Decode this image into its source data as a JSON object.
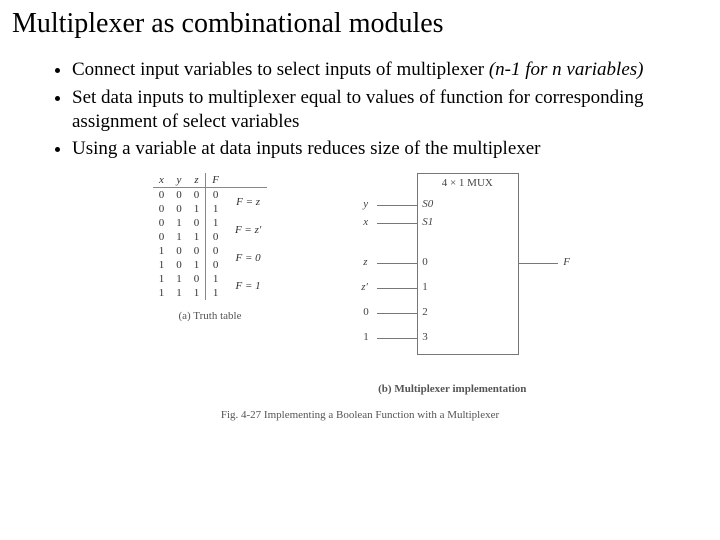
{
  "title": "Multiplexer as combinational modules",
  "bullets": {
    "b1a": "Connect input variables to select inputs of multiplexer ",
    "b1b": "(n-1 for n variables)",
    "b2": "Set data inputs to multiplexer equal to values of function for corresponding assignment of select variables",
    "b3": "Using a variable at data inputs reduces size of the multiplexer"
  },
  "truth_table": {
    "headers": {
      "x": "x",
      "y": "y",
      "z": "z",
      "F": "F"
    },
    "rows": [
      {
        "x": "0",
        "y": "0",
        "z": "0",
        "F": "0",
        "ann": ""
      },
      {
        "x": "0",
        "y": "0",
        "z": "1",
        "F": "1",
        "ann": "F = z"
      },
      {
        "x": "0",
        "y": "1",
        "z": "0",
        "F": "1",
        "ann": ""
      },
      {
        "x": "0",
        "y": "1",
        "z": "1",
        "F": "0",
        "ann": "F = z′"
      },
      {
        "x": "1",
        "y": "0",
        "z": "0",
        "F": "0",
        "ann": ""
      },
      {
        "x": "1",
        "y": "0",
        "z": "1",
        "F": "0",
        "ann": "F = 0"
      },
      {
        "x": "1",
        "y": "1",
        "z": "0",
        "F": "1",
        "ann": ""
      },
      {
        "x": "1",
        "y": "1",
        "z": "1",
        "F": "1",
        "ann": "F = 1"
      }
    ],
    "caption": "(a) Truth table"
  },
  "mux": {
    "title": "4 × 1 MUX",
    "sel": {
      "y": "y",
      "x": "x",
      "s0": "S0",
      "s1": "S1"
    },
    "in": {
      "z": "z",
      "zp": "z′",
      "zero": "0",
      "one": "1",
      "p0": "0",
      "p1": "1",
      "p2": "2",
      "p3": "3"
    },
    "out": "F",
    "caption": "(b) Multiplexer implementation"
  },
  "figure_caption": "Fig. 4-27  Implementing a Boolean Function with a Multiplexer"
}
